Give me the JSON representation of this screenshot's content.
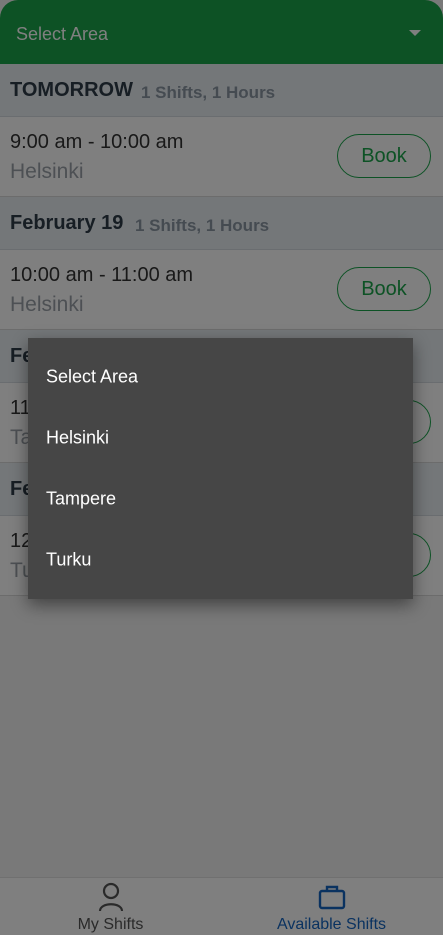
{
  "header": {
    "area_label": "Select Area"
  },
  "groups": [
    {
      "title": "TOMORROW",
      "summary": "1 Shifts, 1 Hours",
      "shift": {
        "time": "9:00 am - 10:00 am",
        "city": "Helsinki",
        "button": "Book"
      }
    },
    {
      "title": "February 19",
      "summary": "1 Shifts, 1 Hours",
      "shift": {
        "time": "10:00 am - 11:00 am",
        "city": "Helsinki",
        "button": "Book"
      }
    },
    {
      "title": "Fe",
      "summary": "",
      "shift": {
        "time": "11",
        "city": "Ta",
        "button": ""
      }
    },
    {
      "title": "Fe",
      "summary": "",
      "shift": {
        "time": "12",
        "city": "Tu",
        "button": ""
      }
    }
  ],
  "dropdown_menu": {
    "items": [
      "Select Area",
      "Helsinki",
      "Tampere",
      "Turku"
    ]
  },
  "bottom_nav": {
    "items": [
      {
        "label": "My Shifts",
        "icon": "person-icon",
        "active": false
      },
      {
        "label": "Available Shifts",
        "icon": "briefcase-icon",
        "active": true
      }
    ]
  },
  "colors": {
    "primary_green": "#1aa44a",
    "active_nav_blue": "#1565c0",
    "menu_background": "#464646"
  }
}
